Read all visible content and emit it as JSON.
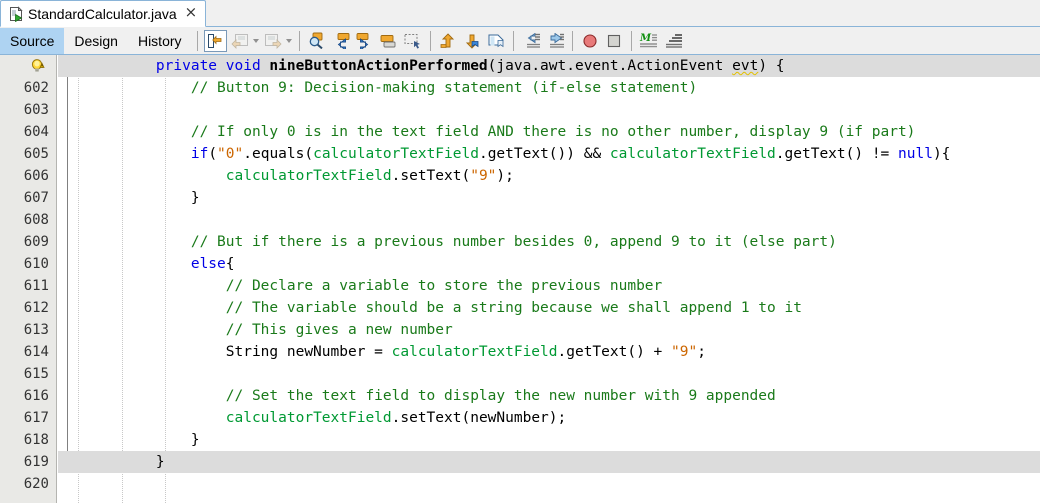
{
  "tab": {
    "filename": "StandardCalculator.java",
    "icon": "java-file-icon",
    "close_label": "×"
  },
  "view_tabs": [
    {
      "label": "Source",
      "selected": true
    },
    {
      "label": "Design",
      "selected": false
    },
    {
      "label": "History",
      "selected": false
    }
  ],
  "toolbar": {
    "buttons": [
      {
        "name": "toggle-rectangular-selection-icon",
        "tooltip": "Toggle Rectangular Selection",
        "boxed": true,
        "enabled": true
      },
      {
        "name": "back-icon",
        "tooltip": "Back",
        "boxed": false,
        "enabled": false,
        "dropdown": true
      },
      {
        "name": "forward-icon",
        "tooltip": "Forward",
        "boxed": false,
        "enabled": false,
        "dropdown": true
      },
      {
        "name": "find-selection-icon",
        "tooltip": "Find Selection",
        "boxed": false,
        "enabled": true
      },
      {
        "name": "find-previous-occurrence-icon",
        "tooltip": "Find Previous Occurrence",
        "boxed": false,
        "enabled": true
      },
      {
        "name": "find-next-occurrence-icon",
        "tooltip": "Find Next Occurrence",
        "boxed": false,
        "enabled": true
      },
      {
        "name": "toggle-highlight-search-icon",
        "tooltip": "Toggle Highlight Search",
        "boxed": false,
        "enabled": true
      },
      {
        "name": "toggle-rectangular-select-icon",
        "tooltip": "Toggle Rectangular Selection",
        "boxed": false,
        "enabled": true
      },
      {
        "name": "previous-bookmark-icon",
        "tooltip": "Previous Bookmark",
        "boxed": false,
        "enabled": true
      },
      {
        "name": "next-bookmark-icon",
        "tooltip": "Next Bookmark",
        "boxed": false,
        "enabled": true
      },
      {
        "name": "toggle-bookmark-icon",
        "tooltip": "Toggle Bookmark",
        "boxed": false,
        "enabled": true
      },
      {
        "name": "shift-line-left-icon",
        "tooltip": "Shift Line Left",
        "boxed": false,
        "enabled": true
      },
      {
        "name": "shift-line-right-icon",
        "tooltip": "Shift Line Right",
        "boxed": false,
        "enabled": true
      },
      {
        "name": "start-macro-recording-icon",
        "tooltip": "Start Macro Recording",
        "boxed": false,
        "enabled": true
      },
      {
        "name": "stop-macro-recording-icon",
        "tooltip": "Stop Macro Recording",
        "boxed": false,
        "enabled": true
      },
      {
        "name": "inspect-members-icon",
        "tooltip": "Inspect Members",
        "boxed": false,
        "enabled": true
      },
      {
        "name": "toggle-comment-icon",
        "tooltip": "Toggle Comment",
        "boxed": false,
        "enabled": true
      }
    ]
  },
  "editor": {
    "gutter_icon": "hint-lightbulb-warning-icon",
    "fold_collapse_icon": "fold-collapse-box-icon",
    "lines": [
      {
        "num": "",
        "highlight": true,
        "indent_guides": 0
      },
      {
        "num": "602",
        "highlight": false,
        "indent_guides": 1
      },
      {
        "num": "603",
        "highlight": false,
        "indent_guides": 1
      },
      {
        "num": "604",
        "highlight": false,
        "indent_guides": 1
      },
      {
        "num": "605",
        "highlight": false,
        "indent_guides": 1
      },
      {
        "num": "606",
        "highlight": false,
        "indent_guides": 2
      },
      {
        "num": "607",
        "highlight": false,
        "indent_guides": 1
      },
      {
        "num": "608",
        "highlight": false,
        "indent_guides": 2
      },
      {
        "num": "609",
        "highlight": false,
        "indent_guides": 1
      },
      {
        "num": "610",
        "highlight": false,
        "indent_guides": 1
      },
      {
        "num": "611",
        "highlight": false,
        "indent_guides": 2
      },
      {
        "num": "612",
        "highlight": false,
        "indent_guides": 2
      },
      {
        "num": "613",
        "highlight": false,
        "indent_guides": 2
      },
      {
        "num": "614",
        "highlight": false,
        "indent_guides": 2
      },
      {
        "num": "615",
        "highlight": false,
        "indent_guides": 3
      },
      {
        "num": "616",
        "highlight": false,
        "indent_guides": 2
      },
      {
        "num": "617",
        "highlight": false,
        "indent_guides": 2
      },
      {
        "num": "618",
        "highlight": false,
        "indent_guides": 1
      },
      {
        "num": "619",
        "highlight": true,
        "indent_guides": 1
      },
      {
        "num": "620",
        "highlight": false,
        "indent_guides": 1
      }
    ],
    "code_lines": [
      [
        {
          "t": "    ",
          "c": "pln"
        },
        {
          "t": "private",
          "c": "kw"
        },
        {
          "t": " ",
          "c": "pln"
        },
        {
          "t": "void",
          "c": "kw"
        },
        {
          "t": " ",
          "c": "pln"
        },
        {
          "t": "nineButtonActionPerformed",
          "c": "mth"
        },
        {
          "t": "(java.awt.event.ActionEvent ",
          "c": "pln"
        },
        {
          "t": "evt",
          "c": "pln warnu"
        },
        {
          "t": ") {",
          "c": "pln"
        }
      ],
      [
        {
          "t": "        ",
          "c": "pln"
        },
        {
          "t": "// Button 9: Decision-making statement (if-else statement)",
          "c": "cmt"
        }
      ],
      [],
      [
        {
          "t": "        ",
          "c": "pln"
        },
        {
          "t": "// If only 0 is in the text field AND there is no other number, display 9 (if part)",
          "c": "cmt"
        }
      ],
      [
        {
          "t": "        ",
          "c": "pln"
        },
        {
          "t": "if",
          "c": "kw"
        },
        {
          "t": "(",
          "c": "pln"
        },
        {
          "t": "\"0\"",
          "c": "str"
        },
        {
          "t": ".equals(",
          "c": "pln"
        },
        {
          "t": "calculatorTextField",
          "c": "fld"
        },
        {
          "t": ".getText()) && ",
          "c": "pln"
        },
        {
          "t": "calculatorTextField",
          "c": "fld"
        },
        {
          "t": ".getText() != ",
          "c": "pln"
        },
        {
          "t": "null",
          "c": "kw"
        },
        {
          "t": "){",
          "c": "pln"
        }
      ],
      [
        {
          "t": "            ",
          "c": "pln"
        },
        {
          "t": "calculatorTextField",
          "c": "fld"
        },
        {
          "t": ".setText(",
          "c": "pln"
        },
        {
          "t": "\"9\"",
          "c": "str"
        },
        {
          "t": ");",
          "c": "pln"
        }
      ],
      [
        {
          "t": "        }",
          "c": "pln"
        }
      ],
      [],
      [
        {
          "t": "        ",
          "c": "pln"
        },
        {
          "t": "// But if there is a previous number besides 0, append 9 to it (else part)",
          "c": "cmt"
        }
      ],
      [
        {
          "t": "        ",
          "c": "pln"
        },
        {
          "t": "else",
          "c": "kw"
        },
        {
          "t": "{",
          "c": "pln"
        }
      ],
      [
        {
          "t": "            ",
          "c": "pln"
        },
        {
          "t": "// Declare a variable to store the previous number",
          "c": "cmt"
        }
      ],
      [
        {
          "t": "            ",
          "c": "pln"
        },
        {
          "t": "// The variable should be a string because we shall append 1 to it",
          "c": "cmt"
        }
      ],
      [
        {
          "t": "            ",
          "c": "pln"
        },
        {
          "t": "// This gives a new number",
          "c": "cmt"
        }
      ],
      [
        {
          "t": "            String newNumber = ",
          "c": "pln"
        },
        {
          "t": "calculatorTextField",
          "c": "fld"
        },
        {
          "t": ".getText() + ",
          "c": "pln"
        },
        {
          "t": "\"9\"",
          "c": "str"
        },
        {
          "t": ";",
          "c": "pln"
        }
      ],
      [],
      [
        {
          "t": "            ",
          "c": "pln"
        },
        {
          "t": "// Set the text field to display the new number with 9 appended",
          "c": "cmt"
        }
      ],
      [
        {
          "t": "            ",
          "c": "pln"
        },
        {
          "t": "calculatorTextField",
          "c": "fld"
        },
        {
          "t": ".setText(newNumber);",
          "c": "pln"
        }
      ],
      [
        {
          "t": "        }",
          "c": "pln"
        }
      ],
      [
        {
          "t": "    }",
          "c": "pln"
        }
      ],
      []
    ]
  },
  "colors": {
    "keyword": "#0000e6",
    "field": "#009933",
    "string": "#cc6600",
    "comment": "#1a7a1a",
    "plain": "#000000",
    "selected_tab_bg": "#aed3f2",
    "gutter_bg": "#e9e9e6",
    "caret_row_bg": "#dcdcdc",
    "warning_underline": "#e3c000"
  }
}
